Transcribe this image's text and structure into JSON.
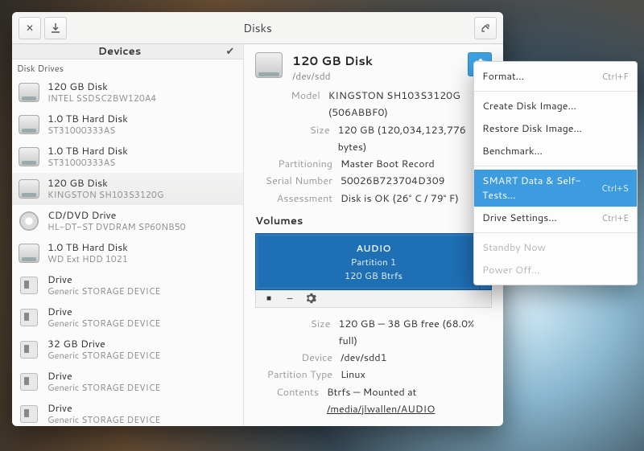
{
  "window": {
    "title": "Disks"
  },
  "sidebar": {
    "header": "Devices",
    "section_label": "Disk Drives",
    "items": [
      {
        "title": "120 GB Disk",
        "subtitle": "INTEL SSDSC2BW120A4",
        "icon": "hdd",
        "selected": false
      },
      {
        "title": "1.0 TB Hard Disk",
        "subtitle": "ST31000333AS",
        "icon": "hdd",
        "selected": false
      },
      {
        "title": "1.0 TB Hard Disk",
        "subtitle": "ST31000333AS",
        "icon": "hdd",
        "selected": false
      },
      {
        "title": "120 GB Disk",
        "subtitle": "KINGSTON SH103S3120G",
        "icon": "hdd",
        "selected": true
      },
      {
        "title": "CD/DVD Drive",
        "subtitle": "HL-DT-ST DVDRAM SP60NB50",
        "icon": "cd",
        "selected": false
      },
      {
        "title": "1.0 TB Hard Disk",
        "subtitle": "WD Ext HDD 1021",
        "icon": "hdd",
        "selected": false
      },
      {
        "title": "Drive",
        "subtitle": "Generic STORAGE DEVICE",
        "icon": "usb",
        "selected": false
      },
      {
        "title": "Drive",
        "subtitle": "Generic STORAGE DEVICE",
        "icon": "usb",
        "selected": false
      },
      {
        "title": "32 GB Drive",
        "subtitle": "Generic STORAGE DEVICE",
        "icon": "usb",
        "selected": false
      },
      {
        "title": "Drive",
        "subtitle": "Generic STORAGE DEVICE",
        "icon": "usb",
        "selected": false
      },
      {
        "title": "Drive",
        "subtitle": "Generic STORAGE DEVICE",
        "icon": "usb",
        "selected": false
      }
    ]
  },
  "details": {
    "title": "120 GB Disk",
    "subtitle": "/dev/sdd",
    "rows": {
      "model_k": "Model",
      "model_v": "KINGSTON SH103S3120G (506ABBF0)",
      "size_k": "Size",
      "size_v": "120 GB (120,034,123,776 bytes)",
      "part_k": "Partitioning",
      "part_v": "Master Boot Record",
      "serial_k": "Serial Number",
      "serial_v": "50026B723704D309",
      "assess_k": "Assessment",
      "assess_v": "Disk is OK (26° C / 79° F)"
    },
    "volumes_label": "Volumes",
    "partition": {
      "name": "AUDIO",
      "label": "Partition 1",
      "size": "120 GB Btrfs"
    },
    "volume_rows": {
      "size_k": "Size",
      "size_v": "120 GB — 38 GB free (68.0% full)",
      "device_k": "Device",
      "device_v": "/dev/sdd1",
      "pt_k": "Partition Type",
      "pt_v": "Linux",
      "contents_k": "Contents",
      "contents_prefix": "Btrfs — Mounted at ",
      "contents_link": "/media/jlwallen/AUDIO"
    }
  },
  "menu": {
    "items": [
      {
        "label": "Format…",
        "accel": "Ctrl+F",
        "state": "normal"
      },
      {
        "sep": true
      },
      {
        "label": "Create Disk Image…",
        "accel": "",
        "state": "normal"
      },
      {
        "label": "Restore Disk Image…",
        "accel": "",
        "state": "normal"
      },
      {
        "label": "Benchmark…",
        "accel": "",
        "state": "normal"
      },
      {
        "sep": true
      },
      {
        "label": "SMART Data & Self-Tests…",
        "accel": "Ctrl+S",
        "state": "highlight"
      },
      {
        "label": "Drive Settings…",
        "accel": "Ctrl+E",
        "state": "normal"
      },
      {
        "sep": true
      },
      {
        "label": "Standby Now",
        "accel": "",
        "state": "disabled"
      },
      {
        "label": "Power Off…",
        "accel": "",
        "state": "disabled"
      }
    ]
  }
}
